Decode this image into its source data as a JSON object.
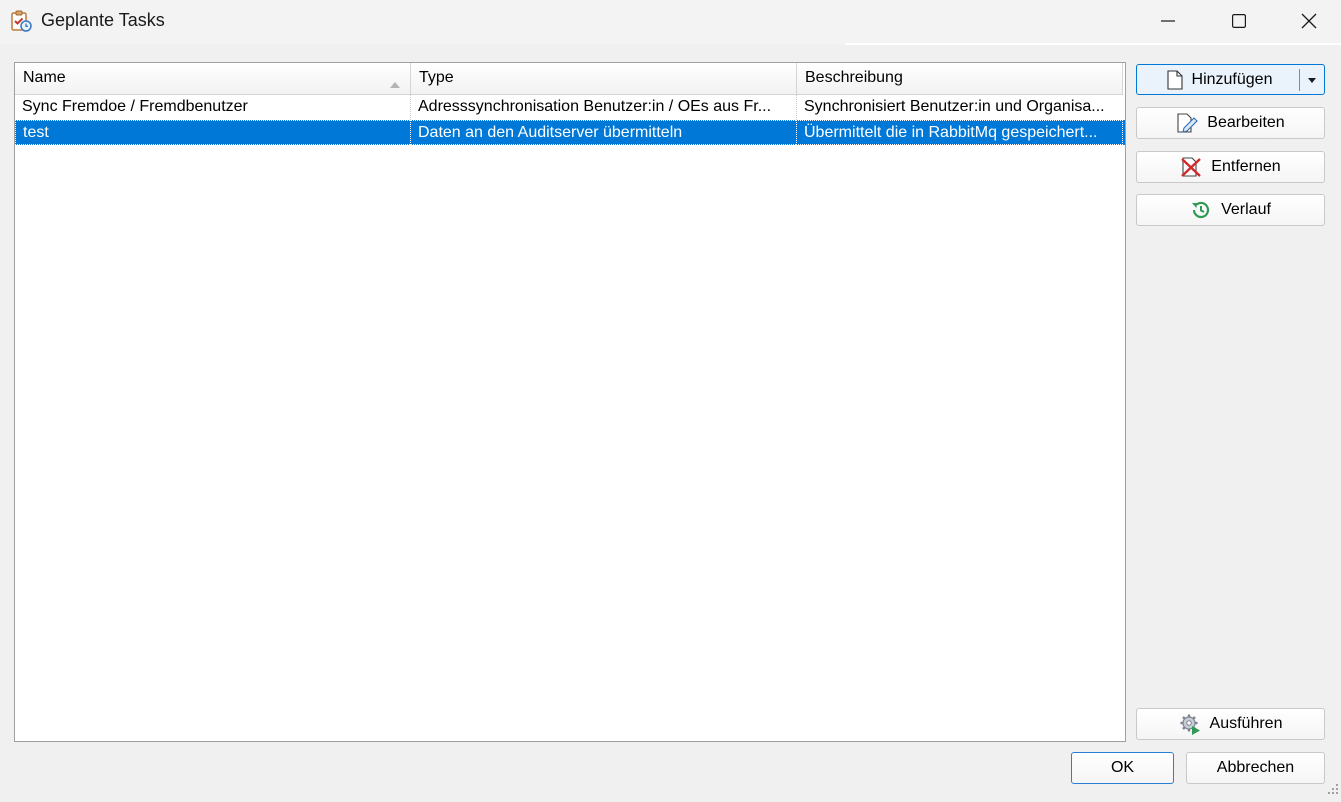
{
  "window": {
    "title": "Geplante Tasks",
    "icon": "task-clipboard-clock-icon",
    "controls": [
      "minimize-icon",
      "maximize-icon",
      "close-icon"
    ]
  },
  "list": {
    "columns": [
      {
        "label": "Name",
        "sort": "ascending"
      },
      {
        "label": "Type"
      },
      {
        "label": "Beschreibung"
      }
    ],
    "rows": [
      {
        "name": "Sync Fremdoe / Fremdbenutzer",
        "type": "Adresssynchronisation Benutzer:in / OEs aus Fr...",
        "description": "Synchronisiert Benutzer:in und Organisa...",
        "selected": false
      },
      {
        "name": "test",
        "type": "Daten an den Auditserver übermitteln",
        "description": "Übermittelt die in RabbitMq gespeichert...",
        "selected": true
      }
    ]
  },
  "actions": {
    "add": {
      "label": "Hinzufügen",
      "icon": "new-document-icon"
    },
    "edit": {
      "label": "Bearbeiten",
      "icon": "edit-document-icon"
    },
    "remove": {
      "label": "Entfernen",
      "icon": "remove-red-x-icon"
    },
    "history": {
      "label": "Verlauf",
      "icon": "history-icon"
    },
    "run": {
      "label": "Ausführen",
      "icon": "run-gear-icon"
    }
  },
  "dialog": {
    "ok": "OK",
    "cancel": "Abbrechen"
  },
  "colors": {
    "selection": "#0078d7",
    "window_bg": "#f0f0f0"
  }
}
